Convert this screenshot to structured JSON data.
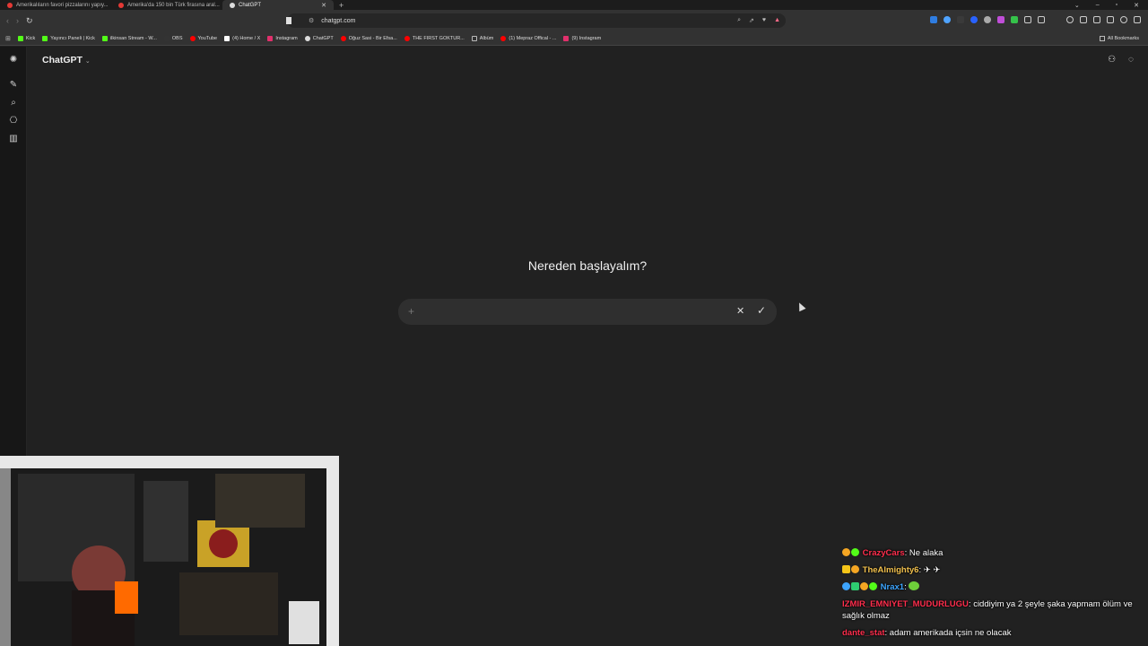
{
  "browser": {
    "tabs": [
      {
        "label": "Amerikalıların favori pizzalarını yapıy..."
      },
      {
        "label": "Amerika'da 150 bin Türk firasına aral..."
      },
      {
        "label": "ChatGPT"
      }
    ],
    "url": "chatgpt.com",
    "bookmarks": [
      {
        "label": "Kick",
        "color": "#53fc18"
      },
      {
        "label": "Yayıncı Paneli | Kick",
        "color": "#53fc18"
      },
      {
        "label": "ilkinsan Stream - W...",
        "color": "#53fc18"
      },
      {
        "label": "OBS",
        "color": "#333333"
      },
      {
        "label": "YouTube",
        "color": "#ff0000"
      },
      {
        "label": "(4) Home / X",
        "color": "#ffffff"
      },
      {
        "label": "Instagram",
        "color": "#e1306c"
      },
      {
        "label": "ChatGPT",
        "color": "#dddddd"
      },
      {
        "label": "Oğuz Sasi - Bir Efsa...",
        "color": "#ff0000"
      },
      {
        "label": "THE FIRST GOKTUR...",
        "color": "#ff0000"
      },
      {
        "label": "Albüm",
        "color": "#bbbbbb"
      },
      {
        "label": "(1) Mepraz Offical - ...",
        "color": "#ff0000"
      },
      {
        "label": "(9) Instagram",
        "color": "#e1306c"
      }
    ],
    "all_bookmarks": "All Bookmarks"
  },
  "app": {
    "model_name": "ChatGPT",
    "heading": "Nereden başlayalım?",
    "composer_value": ""
  },
  "chat": {
    "messages": [
      {
        "user": "CrazyCars",
        "user_color": "#ff2e4d",
        "text": ": Ne alaka",
        "emote": false
      },
      {
        "user": "TheAlmighty6",
        "user_color": "#f2c14e",
        "text": ": ",
        "emote": false,
        "trail": "✈ ✈"
      },
      {
        "user": "Nrax1",
        "user_color": "#3da5ff",
        "text": ": ",
        "emote": true
      },
      {
        "user": "IZMIR_EMNIYET_MUDURLUGU",
        "user_color": "#ff2e4d",
        "text": ": ciddiyim ya 2 şeyle şaka yapmam ölüm ve sağlık olmaz",
        "emote": false
      },
      {
        "user": "dante_stat",
        "user_color": "#ff2e4d",
        "text": ": adam amerikada içsin ne olacak",
        "emote": false
      }
    ]
  },
  "colors": {
    "background": "#212121",
    "sidebar": "#171717",
    "composer": "#2f2f2f"
  }
}
